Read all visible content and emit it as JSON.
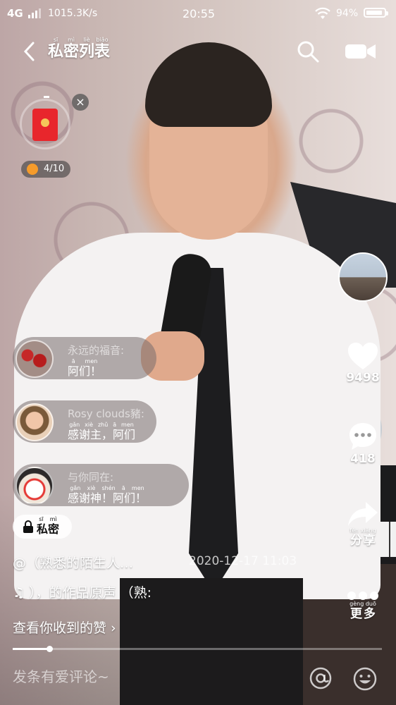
{
  "status_bar": {
    "network": "4G",
    "speed": "1015.3K/s",
    "time": "20:55",
    "battery": "94%"
  },
  "header": {
    "title_chars": [
      {
        "char": "私",
        "pinyin": "sī"
      },
      {
        "char": "密",
        "pinyin": "mì"
      },
      {
        "char": "列",
        "pinyin": "liè"
      },
      {
        "char": "表",
        "pinyin": "biǎo"
      }
    ]
  },
  "red_packet": {
    "progress_text": "4/10",
    "progress_value": 0.4
  },
  "actions": {
    "like_count": "9498",
    "comment_count": "418",
    "share_label": "分享",
    "share_pinyin": "fēn xiǎng",
    "more_label": "更多",
    "more_pinyin": "gèng duō"
  },
  "comments": [
    {
      "name": "永远的福音:",
      "message": "阿们！",
      "message_pinyin": "ā men"
    },
    {
      "name": "Rosy clouds豬:",
      "message": "感谢主，阿们",
      "message_pinyin": "gǎn xiè zhǔ ā men"
    },
    {
      "name": "与你同在:",
      "message": "感谢神！阿们！",
      "message_pinyin": "gǎn xiè shén ā men"
    }
  ],
  "private_badge": {
    "label": "私密",
    "pinyin": "sī mì"
  },
  "description": {
    "line1": "@（熟悉的陌生人…",
    "date": "2020-12-17 11:03",
    "line2": "♫ ），的作品原声 （熟:",
    "likes_link": "查看你收到的赞 ›"
  },
  "video_progress": 0.1,
  "comment_input": {
    "placeholder": "发条有爱评论~"
  },
  "colors": {
    "like": "#ffffff",
    "red_packet": "#e8262c",
    "star": "#f59b2b"
  },
  "icons": [
    "back-icon",
    "search-icon",
    "video-camera-icon",
    "close-icon",
    "heart-icon",
    "comment-icon",
    "share-icon",
    "more-icon",
    "lock-icon",
    "at-icon",
    "emoji-icon",
    "music-note-icon"
  ]
}
